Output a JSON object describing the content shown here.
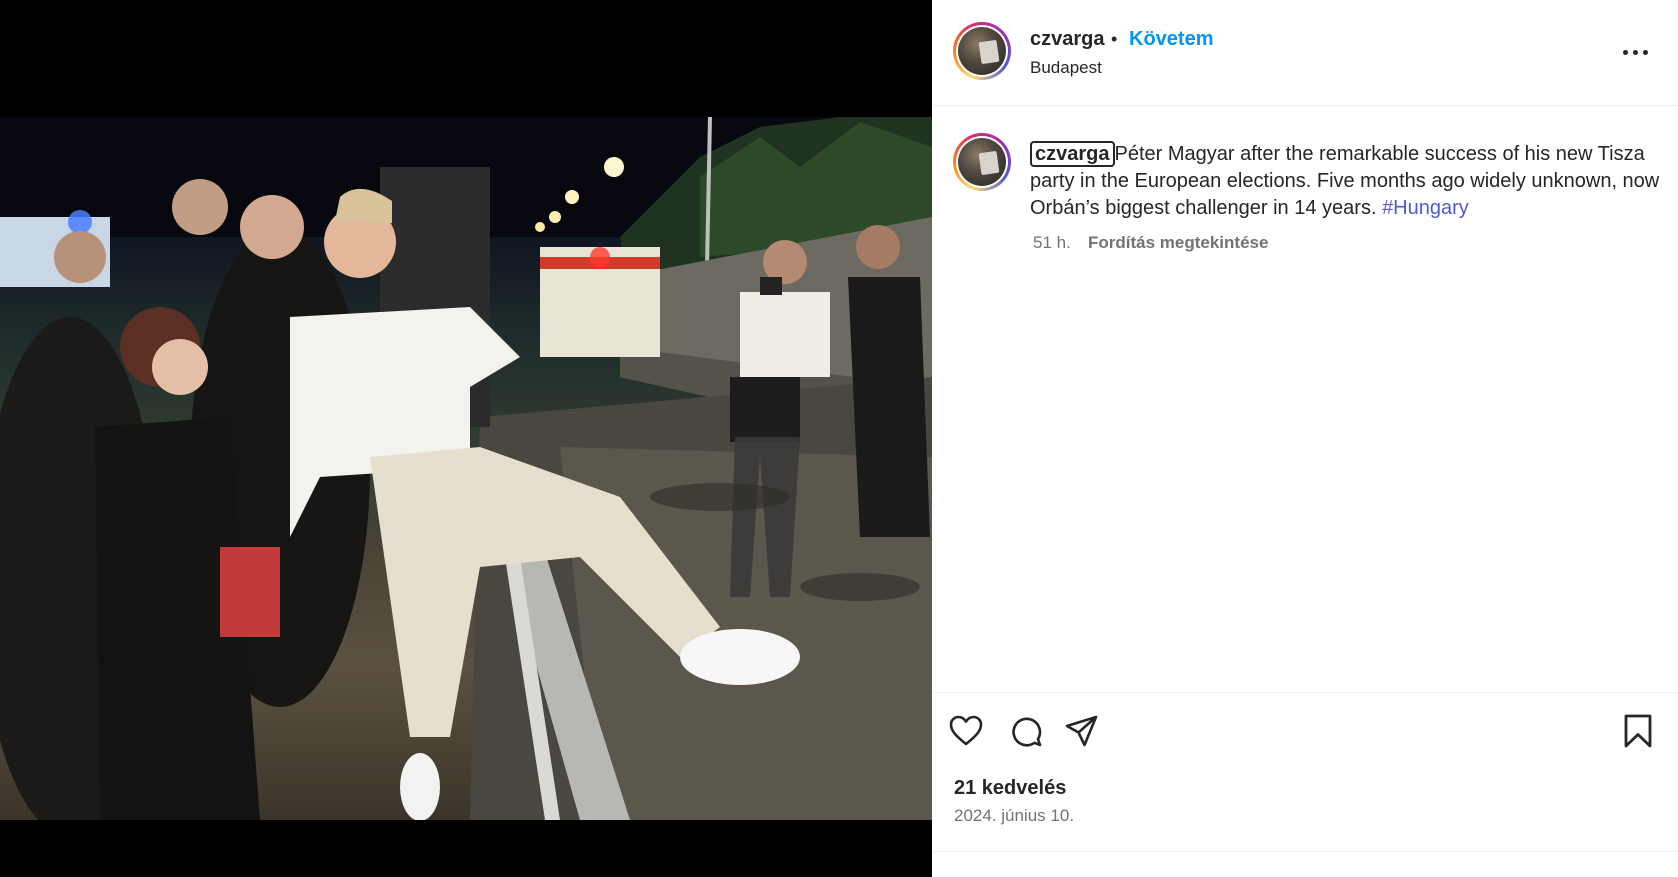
{
  "post": {
    "username": "czvarga",
    "separator": "•",
    "follow_label": "Követem",
    "location": "Budapest",
    "more_icon": "more-options-icon"
  },
  "caption": {
    "username": "czvarga",
    "text": "Péter Magyar after the remarkable success of his new Tisza party in the European elections. Five months ago widely unknown, now Orbán’s biggest challenger in 14 years. ",
    "hashtag": "#Hungary",
    "time": "51 h.",
    "translate_label": "Fordítás megtekintése"
  },
  "actions": {
    "icons": [
      "heart-icon",
      "comment-icon",
      "share-icon",
      "bookmark-icon"
    ]
  },
  "stats": {
    "likes": "21 kedvelés",
    "date": "2024. június 10."
  },
  "colors": {
    "accent": "#0095f6",
    "hashtag": "#4f5bd5",
    "text": "#262626",
    "secondary": "#737373"
  }
}
